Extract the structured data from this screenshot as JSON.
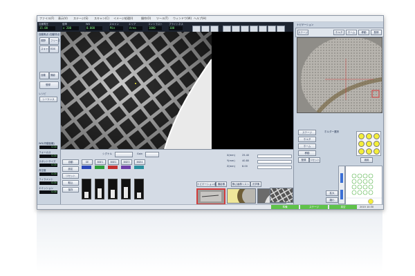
{
  "menu": [
    "ファイル(F)",
    "表示(V)",
    "ステージ(S)",
    "スキャン(C)",
    "イメージ処理(I)",
    "操作(O)",
    "ツール(T)",
    "ウィンドウ(W)",
    "ヘルプ(H)"
  ],
  "toolbar": {
    "items": [
      {
        "label": "加速電圧",
        "value": "15.00"
      },
      {
        "label": "倍率",
        "value": "x 200"
      },
      {
        "label": "WD",
        "value": "0.000"
      },
      {
        "label": "スキャン",
        "value": "Min"
      },
      {
        "label": "エリア",
        "value": "Area"
      },
      {
        "label": "コントラスト",
        "value": "1000"
      },
      {
        "label": "ブライトネス",
        "value": "100"
      }
    ]
  },
  "left_panel": {
    "title": "自動焦点 /自動非点",
    "buttons": [
      "視野",
      "フリーズ",
      "スキャン",
      "EDS",
      "自動",
      "撮影",
      "登録"
    ],
    "readouts": [
      {
        "label": "WD(作動距離)",
        "value": "0.00"
      },
      {
        "label": "フォーカス",
        "value": "0.00"
      },
      {
        "label": "スポットサイズ",
        "value": "0.00"
      },
      {
        "label": "真空度",
        "value": "0.00"
      },
      {
        "label": "フィラメント",
        "value": "0.00"
      },
      {
        "label": "エミッション",
        "value": "0.00"
      }
    ],
    "select_label": "レシピ",
    "select_value": "シーケンス"
  },
  "bottom_panel": {
    "signal_label": "シグナル",
    "gain_label": "Gain",
    "detectors": [
      "SE",
      "BSE1",
      "BSE2",
      "BSE3",
      "BSE4"
    ],
    "detector_colors": [
      "#2c49b8",
      "#2e9c3a",
      "#c43030",
      "#6d3ea8",
      "#2a8f9d"
    ],
    "bar_levels": [
      0.35,
      0.55,
      0.45,
      0.6,
      0.3
    ],
    "buttons": [
      "自動",
      "設定",
      "リセット",
      "取込",
      "保存"
    ],
    "stage_rows": [
      {
        "label": "X(mm)",
        "value": "25.40"
      },
      {
        "label": "Y(mm)",
        "value": "40.80"
      },
      {
        "label": "Z(mm)",
        "value": "8.00"
      }
    ],
    "tabs": [
      "ナビゲーション画像",
      "撮影像",
      "静止画像リスト",
      "光学像"
    ],
    "thumb_selected": 0
  },
  "right_panel": {
    "title": "ナビゲーション",
    "buttons": [
      "ステージ",
      "ホルダ",
      "ホーム",
      "移動",
      "登録",
      "リセット"
    ],
    "holder_title": "ホルダー選択",
    "holder_positions": [
      "1",
      "2",
      "3",
      "4",
      "5",
      "6",
      "7",
      "8",
      "9"
    ],
    "zoom_buttons": [
      "拡大",
      "縮小"
    ],
    "apply_label": "適用"
  },
  "status": {
    "segments": [
      "準備",
      "ステージ",
      "真空"
    ],
    "time": "2015 10:30"
  },
  "colors": {
    "status_green": "#5fc24a",
    "highlight_yellow": "#f4ee3a",
    "panel_blue": "#c9d3df"
  }
}
